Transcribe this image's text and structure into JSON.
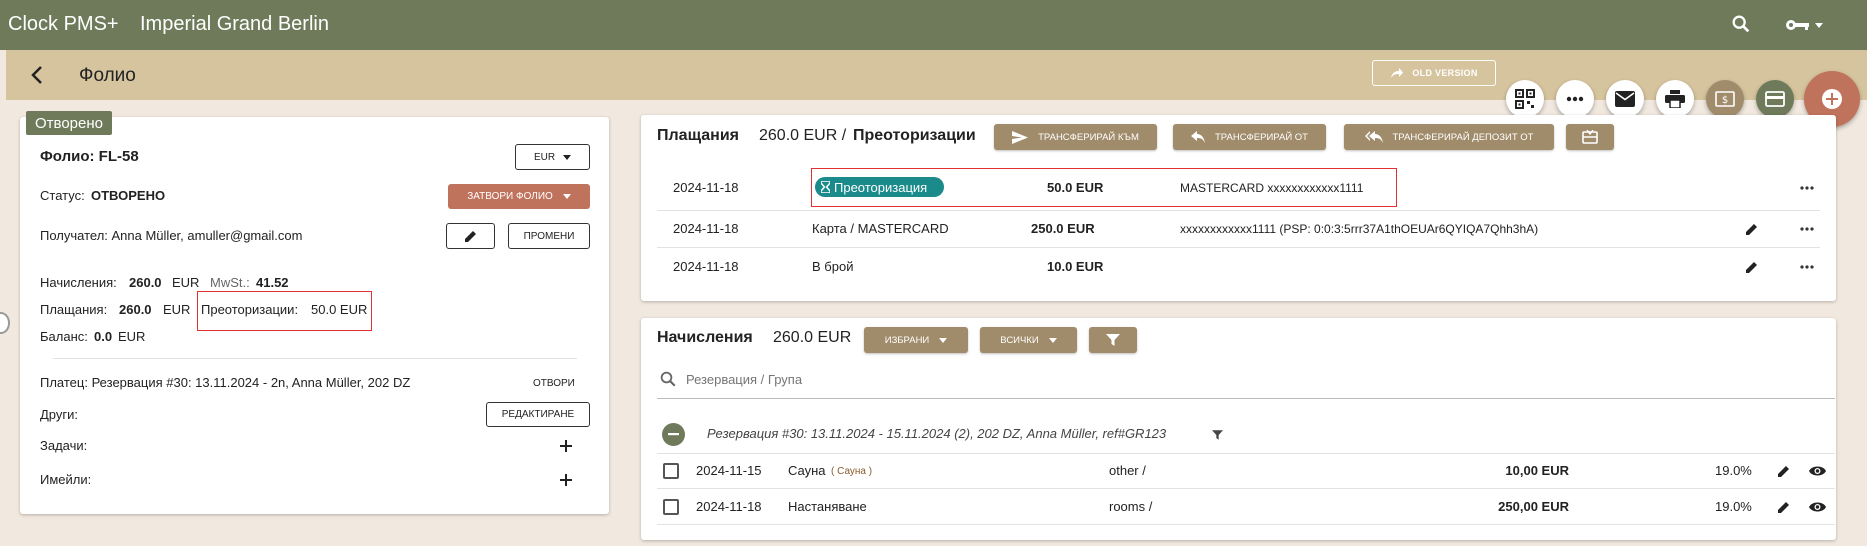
{
  "header": {
    "app_name": "Clock PMS+",
    "hotel_name": "Imperial Grand Berlin"
  },
  "subbar": {
    "title": "Фолио",
    "old_version_label": "OLD VERSION"
  },
  "left": {
    "status_chip": "Отворено",
    "folio_label": "Фолио: FL-58",
    "currency_select": "EUR",
    "status_label": "Статус:",
    "status_value": "ОТВОРЕНО",
    "close_folio_label": "ЗАТВОРИ ФОЛИО",
    "recipient": "Получател: Anna Müller, amuller@gmail.com",
    "change_label": "ПРОМЕНИ",
    "charges_label": "Начисления:",
    "charges_value": "260.0",
    "charges_currency": "EUR",
    "vat_label": "MwSt.:",
    "vat_value": "41.52",
    "payments_label": "Плащания:",
    "payments_value": "260.0",
    "payments_currency": "EUR",
    "preauth_label": "Преоторизации:",
    "preauth_value": "50.0 EUR",
    "balance_label": "Баланс:",
    "balance_value": "0.0",
    "balance_currency": "EUR",
    "payer": "Платец: Резервация #30: 13.11.2024 - 2n, Anna Müller, 202 DZ",
    "open_label": "ОТВОРИ",
    "others_label": "Други:",
    "edit_label": "РЕДАКТИРАНЕ",
    "tasks_label": "Задачи:",
    "emails_label": "Имейли:"
  },
  "payments": {
    "title": "Плащания",
    "amount": "260.0 EUR /",
    "preauth_title": "Преоторизации",
    "btn_transfer_to": "ТРАНСФЕРИРАЙ КЪМ",
    "btn_transfer_from": "ТРАНСФЕРИРАЙ ОТ",
    "btn_transfer_deposit": "ТРАНСФЕРИРАЙ ДЕПОЗИТ ОТ",
    "rows": [
      {
        "date": "2024-11-18",
        "type": "Преоторизация",
        "amount": "50.0 EUR",
        "details": "MASTERCARD xxxxxxxxxxxx1111"
      },
      {
        "date": "2024-11-18",
        "type": "Карта / MASTERCARD",
        "amount": "250.0 EUR",
        "details": "xxxxxxxxxxxx1111 (PSP: 0:0:3:5rrr37A1thOEUAr6QYIQA7Qhh3hA)"
      },
      {
        "date": "2024-11-18",
        "type": "В брой",
        "amount": "10.0 EUR",
        "details": ""
      }
    ]
  },
  "charges": {
    "title": "Начисления",
    "amount": "260.0 EUR",
    "btn_selected": "ИЗБРАНИ",
    "btn_all": "ВСИЧКИ",
    "search_placeholder": "Резервация / Група",
    "group_label": "Резервация #30: 13.11.2024 - 15.11.2024 (2), 202 DZ, Anna Müller, ref#GR123",
    "rows": [
      {
        "date": "2024-11-15",
        "name": "Сауна",
        "sub": "( Сауна )",
        "category": "other /",
        "amount": "10,00 EUR",
        "vat": "19.0%"
      },
      {
        "date": "2024-11-18",
        "name": "Настаняване",
        "sub": "",
        "category": "rooms /",
        "amount": "250,00 EUR",
        "vat": "19.0%"
      }
    ]
  },
  "colors": {
    "topbar": "#6f7a5b",
    "subbar": "#d6c49e",
    "tan_button": "#a08c6a",
    "red_button": "#c0735c",
    "preauth_chip": "#1a8a8a",
    "highlight": "#e03030"
  }
}
